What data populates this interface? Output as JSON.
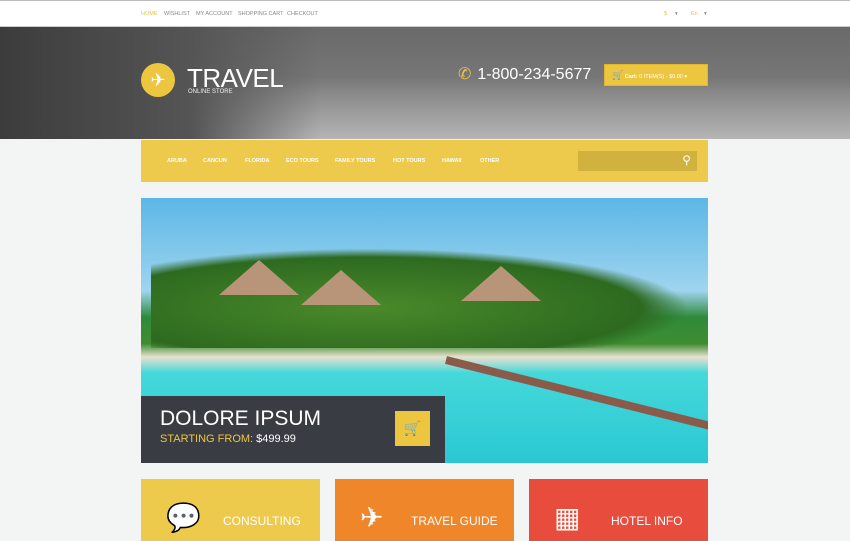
{
  "topbar": {
    "links": [
      "HOME",
      "WISHLIST",
      "MY ACCOUNT",
      "SHOPPING CART",
      "CHECKOUT"
    ],
    "currency": "$",
    "language": "En"
  },
  "header": {
    "logo_title": "TRAVEL",
    "logo_subtitle": "ONLINE STORE",
    "phone": "1-800-234-5677",
    "cart_label": "Cart:",
    "cart_value": "0 ITEM(S) - $0.00"
  },
  "nav": {
    "items": [
      "ARUBA",
      "CANCUN",
      "FLORIDA",
      "ECO TOURS",
      "FAMILY TOURS",
      "HOT TOURS",
      "HAWAII",
      "OTHER"
    ],
    "search_placeholder": ""
  },
  "banner": {
    "title": "DOLORE IPSUM",
    "starting_label": "STARTING FROM:",
    "price": "$499.99"
  },
  "features": [
    {
      "label": "CONSULTING",
      "color": "#edc94c",
      "icon": "chat-icon"
    },
    {
      "label": "TRAVEL GUIDE",
      "color": "#f0862a",
      "icon": "airplane-icon"
    },
    {
      "label": "HOTEL INFO",
      "color": "#e74c3c",
      "icon": "building-icon"
    }
  ],
  "colors": {
    "accent": "#edc640",
    "dark": "#3a3c44"
  }
}
